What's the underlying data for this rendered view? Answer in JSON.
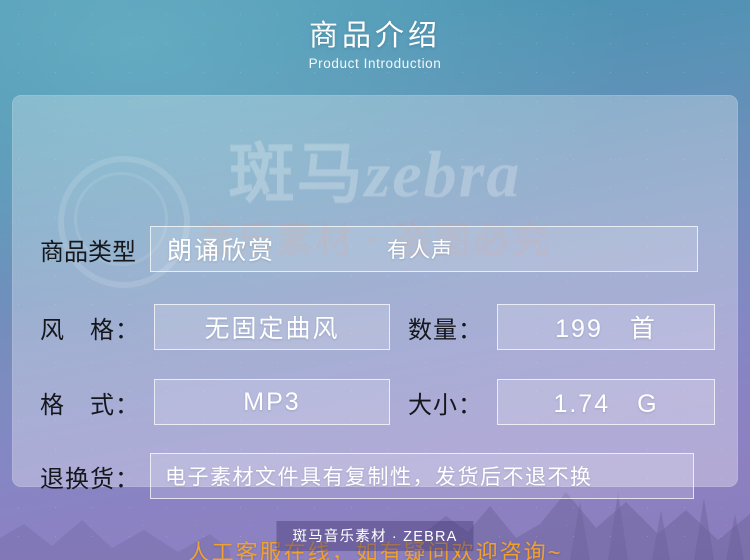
{
  "header": {
    "title": "商品介绍",
    "subtitle": "Product Introduction"
  },
  "watermark": {
    "line1_cn": "斑马",
    "line1_en": "zebra",
    "line2": "音乐素材 · 盗图必究"
  },
  "card": {
    "rows": [
      {
        "label": "商品类型",
        "value": "朗诵欣赏",
        "value2": "有人声"
      },
      {
        "label": "风　格：",
        "value": "无固定曲风",
        "label2": "数量：",
        "value2": "199　首"
      },
      {
        "label": "格　式：",
        "value": "MP3",
        "label2": "大小：",
        "value2": "1.74　G"
      },
      {
        "label": "退换货：",
        "value": "电子素材文件具有复制性，发货后不退不换"
      }
    ],
    "notice": "人工客服在线，如有疑问欢迎咨询~"
  },
  "footer": {
    "brand": "斑马音乐素材 · ZEBRA"
  },
  "colors": {
    "accent_orange": "#f0a02e",
    "label_dark": "#15171c",
    "value_white": "#ffffff",
    "bg_top": "#4e97b4",
    "bg_bottom": "#8a7dbd",
    "footer_bar": "#483c78"
  }
}
